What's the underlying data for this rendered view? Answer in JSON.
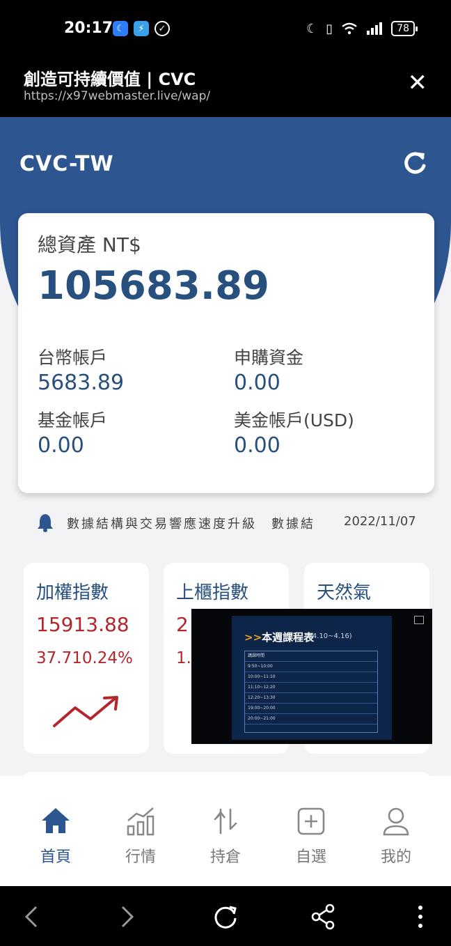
{
  "status_bar": {
    "time": "20:17",
    "battery": "78",
    "icons": [
      "moon-icon",
      "shield-icon",
      "vpn-icon",
      "do-not-disturb-icon",
      "vibrate-icon",
      "wifi-icon",
      "signal-icon"
    ]
  },
  "browser": {
    "title": "創造可持續價值 | CVC",
    "url": "https://x97webmaster.live/wap/",
    "close_icon": "close-icon"
  },
  "header": {
    "brand": "CVC-TW",
    "refresh_icon": "refresh-icon",
    "color": "#2d5590"
  },
  "assets": {
    "total_label": "總資產 NT$",
    "total_value": "105683.89",
    "items": [
      {
        "label": "台幣帳戶",
        "value": "5683.89"
      },
      {
        "label": "申購資金",
        "value": "0.00"
      },
      {
        "label": "基金帳戶",
        "value": "0.00"
      },
      {
        "label": "美金帳戶(USD)",
        "value": "0.00"
      }
    ]
  },
  "notice": {
    "text": "數據結構與交易響應速度升級　數據結",
    "date": "2022/11/07",
    "icon": "bell-icon"
  },
  "indices": [
    {
      "name": "加權指數",
      "value": "15913.88",
      "change": "37.710.24%",
      "trend_icon": "trend-up-icon"
    },
    {
      "name": "上櫃指數",
      "value": "2",
      "change": "1."
    },
    {
      "name": "天然氣",
      "value": "",
      "change": ""
    }
  ],
  "video": {
    "title_prefix": ">>",
    "title": "本週課程表",
    "subtitle": "(4.10~4.16)",
    "rows": [
      "講課時間",
      "9:50~10:00",
      "10:00~11:10",
      "11:10~12:20",
      "12:20~13:30",
      "19:00~20:00",
      "20:00~21:00"
    ]
  },
  "tabs": [
    {
      "label": "首頁",
      "icon": "home-icon",
      "active": true
    },
    {
      "label": "行情",
      "icon": "chart-icon",
      "active": false
    },
    {
      "label": "持倉",
      "icon": "swap-icon",
      "active": false
    },
    {
      "label": "自選",
      "icon": "add-square-icon",
      "active": false
    },
    {
      "label": "我的",
      "icon": "user-icon",
      "active": false
    }
  ],
  "nav": {
    "back_icon": "back-icon",
    "forward_icon": "forward-icon",
    "reload_icon": "reload-icon",
    "share_icon": "share-icon",
    "more_icon": "more-icon"
  }
}
